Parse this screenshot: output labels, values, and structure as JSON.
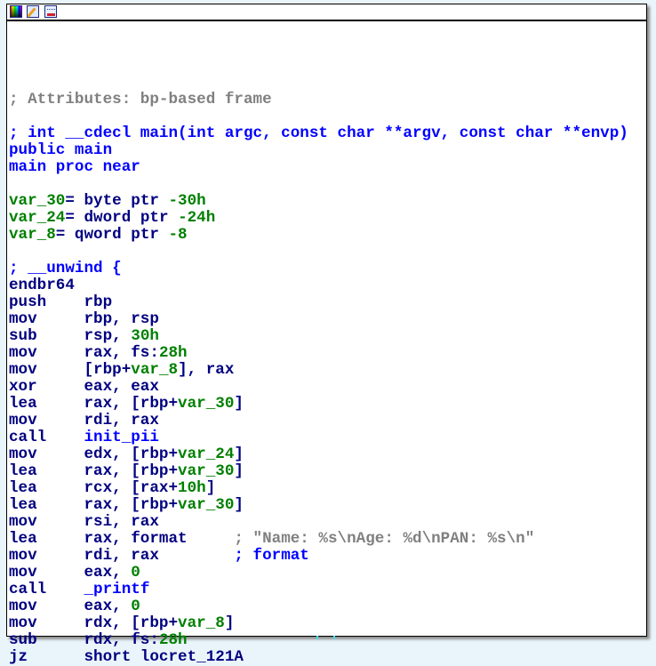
{
  "toolbar": {
    "icons": [
      "color-palette-icon",
      "edit-node-icon",
      "graph-layout-icon"
    ]
  },
  "colors": {
    "instruction": "#000080",
    "number_or_var": "#008000",
    "name": "#0000ff",
    "comment": "#808080"
  },
  "lines": [
    [],
    [],
    [
      [
        "; Attributes: bp-based frame",
        "c"
      ]
    ],
    [],
    [
      [
        "; int __cdecl main(int argc, const char **argv, const char **envp)",
        "b"
      ]
    ],
    [
      [
        "public main",
        "b"
      ]
    ],
    [
      [
        "main proc near",
        "b"
      ]
    ],
    [],
    [
      [
        "var_30",
        "n"
      ],
      [
        "= byte ptr ",
        "i"
      ],
      [
        "-30h",
        "n"
      ]
    ],
    [
      [
        "var_24",
        "n"
      ],
      [
        "= dword ptr ",
        "i"
      ],
      [
        "-24h",
        "n"
      ]
    ],
    [
      [
        "var_8",
        "n"
      ],
      [
        "= qword ptr ",
        "i"
      ],
      [
        "-8",
        "n"
      ]
    ],
    [],
    [
      [
        "; __unwind {",
        "b"
      ]
    ],
    [
      [
        "endbr64",
        "i"
      ]
    ],
    [
      [
        "push    rbp",
        "i"
      ]
    ],
    [
      [
        "mov     rbp, rsp",
        "i"
      ]
    ],
    [
      [
        "sub     rsp, ",
        "i"
      ],
      [
        "30h",
        "n"
      ]
    ],
    [
      [
        "mov     rax, fs:",
        "i"
      ],
      [
        "28h",
        "n"
      ]
    ],
    [
      [
        "mov     [rbp+",
        "i"
      ],
      [
        "var_8",
        "n"
      ],
      [
        "], rax",
        "i"
      ]
    ],
    [
      [
        "xor     eax, eax",
        "i"
      ]
    ],
    [
      [
        "lea     rax, [rbp+",
        "i"
      ],
      [
        "var_30",
        "n"
      ],
      [
        "]",
        "i"
      ]
    ],
    [
      [
        "mov     rdi, rax",
        "i"
      ]
    ],
    [
      [
        "call    ",
        "i"
      ],
      [
        "init_pii",
        "b"
      ]
    ],
    [
      [
        "mov     edx, [rbp+",
        "i"
      ],
      [
        "var_24",
        "n"
      ],
      [
        "]",
        "i"
      ]
    ],
    [
      [
        "lea     rax, [rbp+",
        "i"
      ],
      [
        "var_30",
        "n"
      ],
      [
        "]",
        "i"
      ]
    ],
    [
      [
        "lea     rcx, [rax+",
        "i"
      ],
      [
        "10h",
        "n"
      ],
      [
        "]",
        "i"
      ]
    ],
    [
      [
        "lea     rax, [rbp+",
        "i"
      ],
      [
        "var_30",
        "n"
      ],
      [
        "]",
        "i"
      ]
    ],
    [
      [
        "mov     rsi, rax",
        "i"
      ]
    ],
    [
      [
        "lea     rax, format     ",
        "i"
      ],
      [
        "; \"Name: %s\\nAge: %d\\nPAN: %s\\n\"",
        "c"
      ]
    ],
    [
      [
        "mov     rdi, rax        ",
        "i"
      ],
      [
        "; format",
        "b"
      ]
    ],
    [
      [
        "mov     eax, ",
        "i"
      ],
      [
        "0",
        "n"
      ]
    ],
    [
      [
        "call    ",
        "i"
      ],
      [
        "_printf",
        "b"
      ]
    ],
    [
      [
        "mov     eax, ",
        "i"
      ],
      [
        "0",
        "n"
      ]
    ],
    [
      [
        "mov     rdx, [rbp+",
        "i"
      ],
      [
        "var_8",
        "n"
      ],
      [
        "]",
        "i"
      ]
    ],
    [
      [
        "sub     rdx, fs:",
        "i"
      ],
      [
        "28h",
        "n"
      ]
    ],
    [
      [
        "jz      short locret_121A",
        "i"
      ]
    ]
  ]
}
